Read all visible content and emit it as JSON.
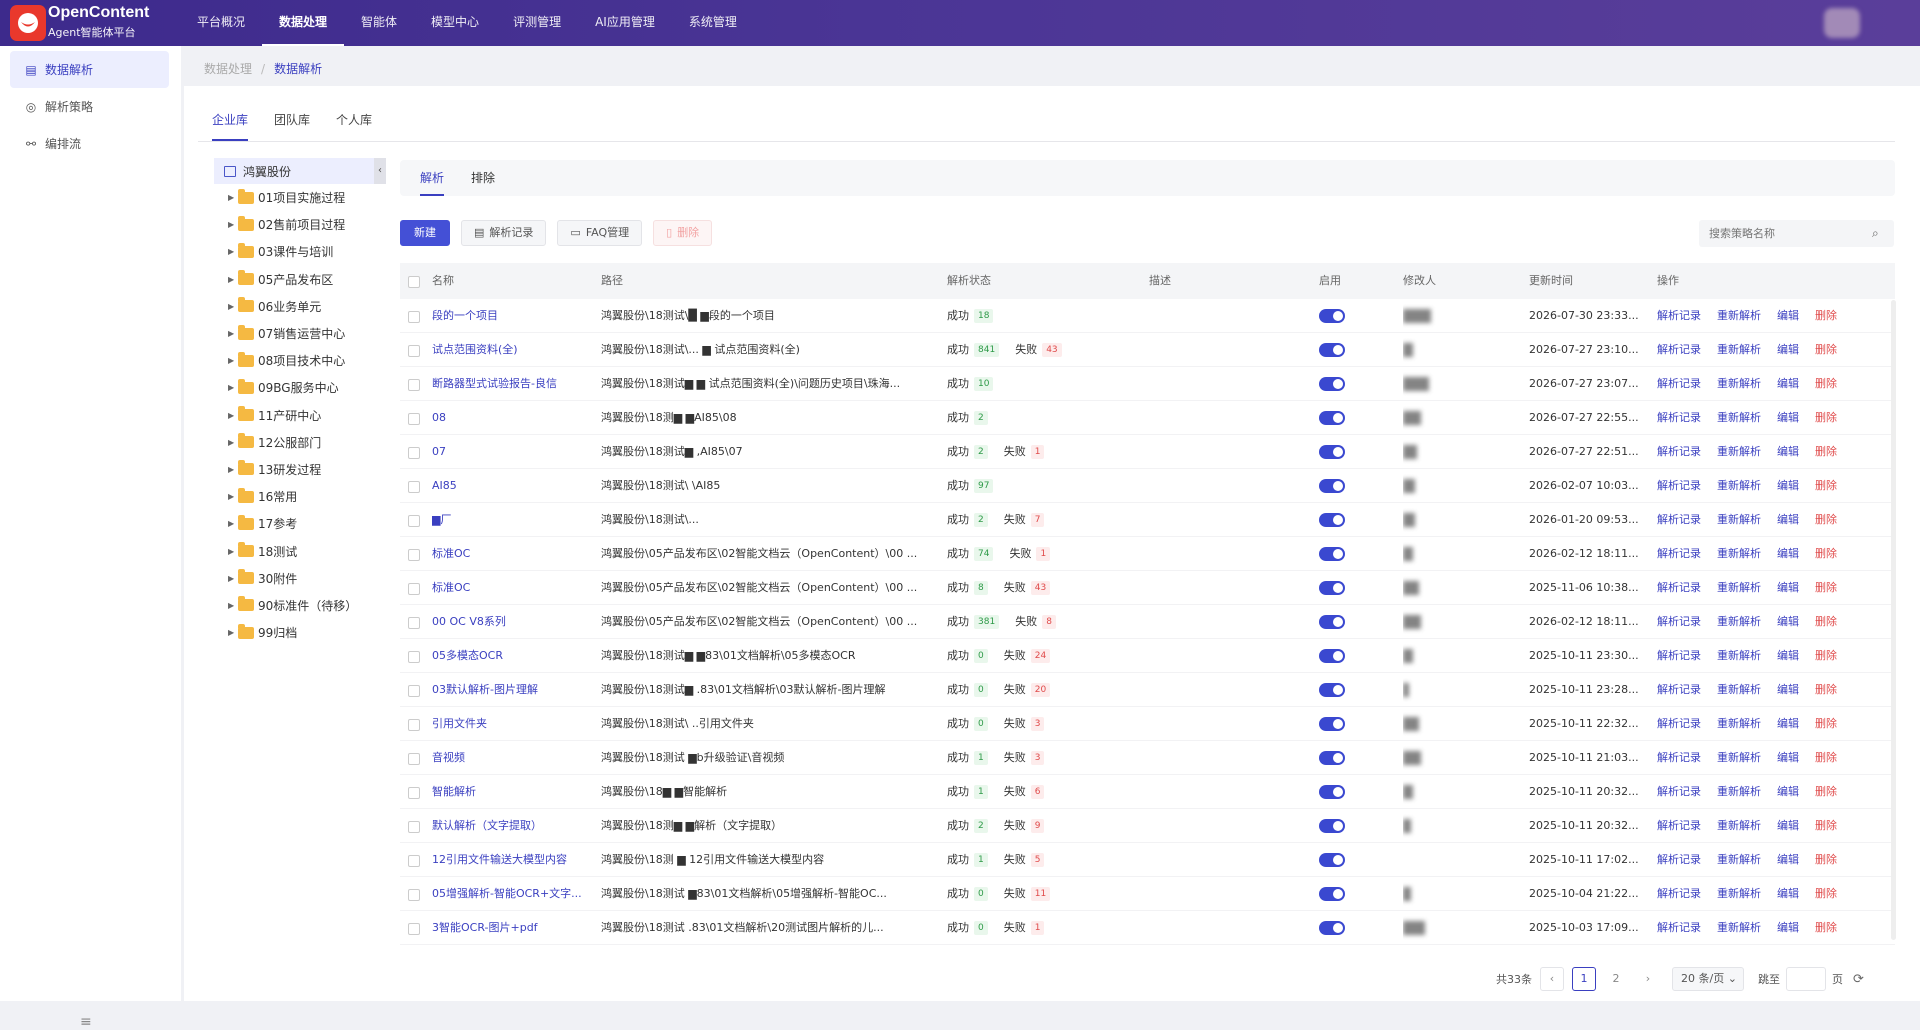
{
  "brand": {
    "name": "OpenContent",
    "subtitle": "Agent智能体平台"
  },
  "nav": [
    "平台概况",
    "数据处理",
    "智能体",
    "模型中心",
    "评测管理",
    "AI应用管理",
    "系统管理"
  ],
  "nav_active": 1,
  "sidebar": [
    {
      "label": "数据解析",
      "icon": "chart-icon",
      "active": true
    },
    {
      "label": "解析策略",
      "icon": "compass-icon",
      "active": false
    },
    {
      "label": "编排流",
      "icon": "flow-icon",
      "active": false
    }
  ],
  "breadcrumb": {
    "parent": "数据处理",
    "current": "数据解析"
  },
  "lib_tabs": [
    "企业库",
    "团队库",
    "个人库"
  ],
  "tree": {
    "root": "鸿翼股份",
    "nodes": [
      "01项目实施过程",
      "02售前项目过程",
      "03课件与培训",
      "05产品发布区",
      "06业务单元",
      "07销售运营中心",
      "08项目技术中心",
      "09BG服务中心",
      "11产研中心",
      "12公服部门",
      "13研发过程",
      "16常用",
      "17参考",
      "18测试",
      "30附件",
      "90标准件（待移）",
      "99归档"
    ]
  },
  "sub_tabs": [
    "解析",
    "排除"
  ],
  "toolbar": {
    "new": "新建",
    "records": "解析记录",
    "faq": "FAQ管理",
    "delete": "删除"
  },
  "search": {
    "placeholder": "搜索策略名称"
  },
  "columns": [
    "名称",
    "路径",
    "解析状态",
    "描述",
    "启用",
    "修改人",
    "更新时间",
    "操作"
  ],
  "ops": [
    "解析记录",
    "重新解析",
    "编辑",
    "删除"
  ],
  "status_labels": {
    "ok": "成功",
    "fail": "失败"
  },
  "rows": [
    {
      "name": "段的一个项目",
      "path": "鸿翼股份\\18测试\\█ ▆段的一个项目",
      "ok": "18",
      "fail": "",
      "time": "2026-07-30 23:33..."
    },
    {
      "name": "试点范围资料(全)",
      "path": "鸿翼股份\\18测试\\... ▆ 试点范围资料(全)",
      "ok": "841",
      "fail": "43",
      "time": "2026-07-27 23:10..."
    },
    {
      "name": "断路器型式试验报告-良信",
      "path": "鸿翼股份\\18测试▆ ▆ 试点范围资料(全)\\问题历史项目\\珠海...",
      "ok": "10",
      "fail": "",
      "time": "2026-07-27 23:07..."
    },
    {
      "name": "08",
      "path": "鸿翼股份\\18测▆ ▆AI85\\08",
      "ok": "2",
      "fail": "",
      "time": "2026-07-27 22:55..."
    },
    {
      "name": "07",
      "path": "鸿翼股份\\18测试▆ ,AI85\\07",
      "ok": "2",
      "fail": "1",
      "time": "2026-07-27 22:51..."
    },
    {
      "name": "AI85",
      "path": "鸿翼股份\\18测试\\ \\AI85",
      "ok": "97",
      "fail": "",
      "time": "2026-02-07 10:03..."
    },
    {
      "name": "▆厂",
      "path": "鸿翼股份\\18测试\\...",
      "ok": "2",
      "fail": "7",
      "time": "2026-01-20 09:53..."
    },
    {
      "name": "标准OC",
      "path": "鸿翼股份\\05产品发布区\\02智能文档云（OpenContent）\\00 ...",
      "ok": "74",
      "fail": "1",
      "time": "2026-02-12 18:11..."
    },
    {
      "name": "标准OC",
      "path": "鸿翼股份\\05产品发布区\\02智能文档云（OpenContent）\\00 ...",
      "ok": "8",
      "fail": "43",
      "time": "2025-11-06 10:38..."
    },
    {
      "name": "00 OC V8系列",
      "path": "鸿翼股份\\05产品发布区\\02智能文档云（OpenContent）\\00 ...",
      "ok": "381",
      "fail": "8",
      "time": "2026-02-12 18:11..."
    },
    {
      "name": "05多模态OCR",
      "path": "鸿翼股份\\18测试▆ ▆83\\01文档解析\\05多模态OCR",
      "ok": "0",
      "fail": "24",
      "time": "2025-10-11 23:30..."
    },
    {
      "name": "03默认解析-图片理解",
      "path": "鸿翼股份\\18测试▆ .83\\01文档解析\\03默认解析-图片理解",
      "ok": "0",
      "fail": "20",
      "time": "2025-10-11 23:28..."
    },
    {
      "name": "引用文件夹",
      "path": "鸿翼股份\\18测试\\ ..引用文件夹",
      "ok": "0",
      "fail": "3",
      "time": "2025-10-11 22:32..."
    },
    {
      "name": "音视频",
      "path": "鸿翼股份\\18测试 ▆b升级验证\\音视频",
      "ok": "1",
      "fail": "3",
      "time": "2025-10-11 21:03..."
    },
    {
      "name": "智能解析",
      "path": "鸿翼股份\\18▆ ▆智能解析",
      "ok": "1",
      "fail": "6",
      "time": "2025-10-11 20:32..."
    },
    {
      "name": "默认解析（文字提取）",
      "path": "鸿翼股份\\18测▆ ▆解析（文字提取）",
      "ok": "2",
      "fail": "9",
      "time": "2025-10-11 20:32..."
    },
    {
      "name": "12引用文件输送大模型内容",
      "path": "鸿翼股份\\18测 ▆ 12引用文件输送大模型内容",
      "ok": "1",
      "fail": "5",
      "time": "2025-10-11 17:02..."
    },
    {
      "name": "05增强解析-智能OCR+文字...",
      "path": "鸿翼股份\\18测试 ▆83\\01文档解析\\05增强解析-智能OC...",
      "ok": "0",
      "fail": "11",
      "time": "2025-10-04 21:22..."
    },
    {
      "name": "3智能OCR-图片+pdf",
      "path": "鸿翼股份\\18测试 .83\\01文档解析\\20测试图片解析的儿...",
      "ok": "0",
      "fail": "1",
      "time": "2025-10-03 17:09..."
    }
  ],
  "pager": {
    "total": "共33条",
    "page1": "1",
    "page2": "2",
    "size": "20 条/页",
    "jump": "跳至",
    "unit": "页"
  }
}
